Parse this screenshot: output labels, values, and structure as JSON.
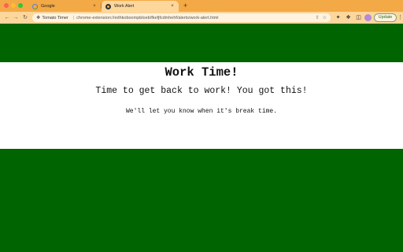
{
  "browser": {
    "tabs": [
      {
        "title": "Google",
        "favicon": "google-icon",
        "active": false
      },
      {
        "title": "Work Alert",
        "favicon": "tomato-icon",
        "active": true
      }
    ],
    "new_tab_glyph": "+",
    "close_glyph": "×",
    "address_bar": {
      "extension_name": "Tomato Timer",
      "url": "chrome-extension://edhkoboompbloeb/fkefjfcdmhehf/alerts/work-alert.html"
    },
    "update_label": "Update",
    "colors": {
      "frame": "#f3a945",
      "toolbar": "#fcd69b"
    }
  },
  "page": {
    "heading": "Work Time!",
    "subtitle": "Time to get back to work! You got this!",
    "note": "We'll let you know when it's break time.",
    "colors": {
      "background": "#006400",
      "band": "#ffffff"
    }
  }
}
